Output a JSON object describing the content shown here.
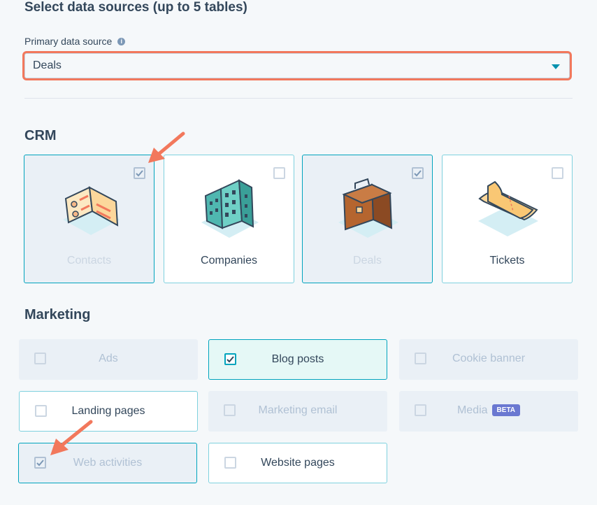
{
  "header": {
    "title": "Select data sources (up to 5 tables)"
  },
  "primary": {
    "label": "Primary data source",
    "value": "Deals"
  },
  "crm": {
    "heading": "CRM",
    "cards": [
      {
        "label": "Contacts",
        "checked": true,
        "selected": true
      },
      {
        "label": "Companies",
        "checked": false,
        "selected": false
      },
      {
        "label": "Deals",
        "checked": true,
        "selected": true
      },
      {
        "label": "Tickets",
        "checked": false,
        "selected": false
      }
    ]
  },
  "marketing": {
    "heading": "Marketing",
    "tiles": [
      {
        "label": "Ads",
        "state": "disabled"
      },
      {
        "label": "Blog posts",
        "state": "checked"
      },
      {
        "label": "Cookie banner",
        "state": "disabled"
      },
      {
        "label": "Landing pages",
        "state": "unchecked"
      },
      {
        "label": "Marketing email",
        "state": "disabled"
      },
      {
        "label": "Media",
        "state": "disabled",
        "badge": "BETA"
      },
      {
        "label": "Web activities",
        "state": "checked-disabled"
      },
      {
        "label": "Website pages",
        "state": "unchecked"
      }
    ]
  },
  "colors": {
    "accent": "#00a4bd",
    "arrow": "#f2785c",
    "text": "#33475b",
    "disabled_text": "#b0c1d4"
  }
}
